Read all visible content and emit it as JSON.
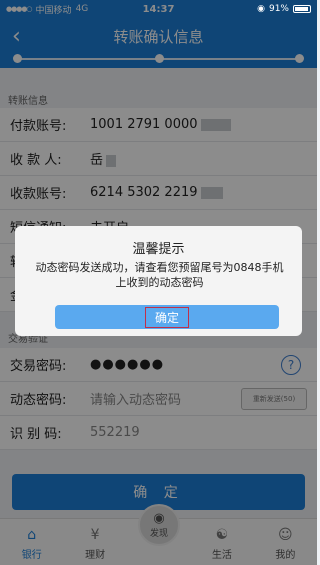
{
  "status": {
    "carrier": "中国移动",
    "network": "4G",
    "time": "14:37",
    "battery": "91%"
  },
  "nav": {
    "back_icon": "chevron-left-icon",
    "title": "转账确认信息"
  },
  "transfer_info": {
    "section_label": "转账信息",
    "rows": [
      {
        "label": "付款账号:",
        "value": "1001 2791 0000"
      },
      {
        "label": "收 款 人:",
        "value": "岳"
      },
      {
        "label": "收款账号:",
        "value": "6214 5302 2219"
      },
      {
        "label": "短信通知:",
        "value": "未开启"
      },
      {
        "label": "转",
        "value": ""
      },
      {
        "label": "金",
        "value": ""
      }
    ]
  },
  "transaction": {
    "section_label": "交易验证",
    "rows": [
      {
        "label": "交易密码:",
        "value": "●●●●●●"
      },
      {
        "label": "动态密码:",
        "placeholder": "请输入动态密码",
        "resend": "重新发送(50)"
      },
      {
        "label": "识 别 码:",
        "value": "552219"
      }
    ]
  },
  "confirm_button": "确 定",
  "tabs": [
    {
      "label": "银行",
      "icon": "home-icon"
    },
    {
      "label": "理财",
      "icon": "money-bag-icon"
    },
    {
      "label": "发现",
      "icon": "eye-icon"
    },
    {
      "label": "生活",
      "icon": "life-icon"
    },
    {
      "label": "我的",
      "icon": "person-icon"
    }
  ],
  "dialog": {
    "title": "温馨提示",
    "message": "动态密码发送成功，请查看您预留尾号为0848手机上收到的动态密码",
    "button": "确定"
  },
  "colors": {
    "primary": "#1d7fd8",
    "dialog_button": "#5aa9ef",
    "highlight_border": "#c0304a"
  }
}
